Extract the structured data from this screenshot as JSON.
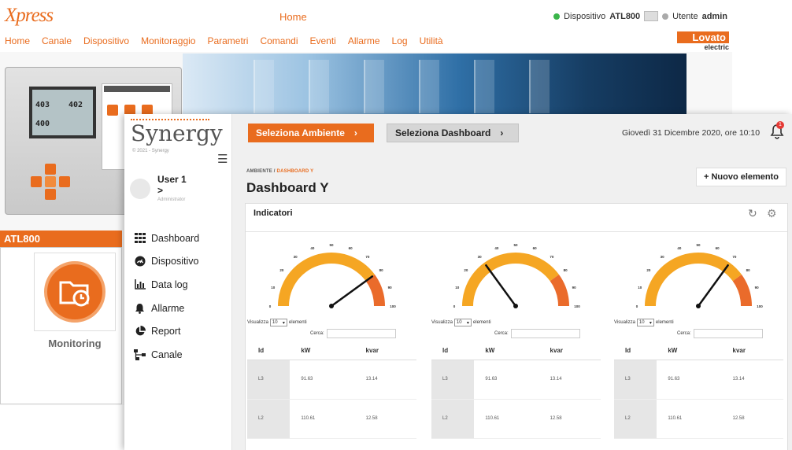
{
  "xpress": {
    "logo": "Xpress",
    "title": "Home",
    "device_label": "Dispositivo",
    "device_value": "ATL800",
    "user_label": "Utente",
    "user_value": "admin",
    "menu": [
      "Home",
      "Canale",
      "Dispositivo",
      "Monitoraggio",
      "Parametri",
      "Comandi",
      "Eventi",
      "Allarme",
      "Log",
      "Utilità"
    ],
    "brand": "Lovato",
    "brand_sub": "electric",
    "device_card_title": "ATL800",
    "tile_label": "Monitoring",
    "status_color": "#3ab54a",
    "accent": "#e96c1e"
  },
  "synergy": {
    "logo": "Synergy",
    "copyright": "© 2021 - Synergy",
    "user": {
      "name": "User 1",
      "chevron": ">",
      "role": "Administrator"
    },
    "nav": [
      {
        "label": "Dashboard",
        "icon": "dashboard-grid-icon"
      },
      {
        "label": "Dispositivo",
        "icon": "device-icon"
      },
      {
        "label": "Data log",
        "icon": "chart-icon"
      },
      {
        "label": "Allarme",
        "icon": "bell-icon"
      },
      {
        "label": "Report",
        "icon": "pie-icon"
      },
      {
        "label": "Canale",
        "icon": "network-icon"
      }
    ],
    "topbar": {
      "select_env": "Seleziona Ambiente",
      "select_dash": "Seleziona Dashboard",
      "date": "Giovedì 31 Dicembre 2020, ore 10:10",
      "notifications": "1"
    },
    "breadcrumb": {
      "root": "AMBIENTE",
      "sep": " / ",
      "current": "DASHBOARD Y"
    },
    "page_title": "Dashboard Y",
    "new_button": "+ Nuovo elemento",
    "panel_title": "Indicatori",
    "widgets": [
      {
        "gauge_value": 80,
        "ticks": [
          "0",
          "10",
          "20",
          "30",
          "40",
          "50",
          "60",
          "70",
          "80",
          "90",
          "100"
        ],
        "show_prefix": "Visualizza",
        "show_value": "10",
        "show_suffix": "elementi",
        "search_label": "Cerca:",
        "columns": [
          "Id",
          "kW",
          "kvar"
        ],
        "rows": [
          {
            "id": "L3",
            "kw": "91.63",
            "kvar": "13.14"
          },
          {
            "id": "L2",
            "kw": "110.61",
            "kvar": "12.58"
          }
        ]
      },
      {
        "gauge_value": 30,
        "ticks": [
          "0",
          "10",
          "20",
          "30",
          "40",
          "50",
          "60",
          "70",
          "80",
          "90",
          "100"
        ],
        "show_prefix": "Visualizza",
        "show_value": "10",
        "show_suffix": "elementi",
        "search_label": "Cerca:",
        "columns": [
          "Id",
          "kW",
          "kvar"
        ],
        "rows": [
          {
            "id": "L3",
            "kw": "91.63",
            "kvar": "13.14"
          },
          {
            "id": "L2",
            "kw": "110.61",
            "kvar": "12.58"
          }
        ]
      },
      {
        "gauge_value": 70,
        "ticks": [
          "0",
          "10",
          "20",
          "30",
          "40",
          "50",
          "60",
          "70",
          "80",
          "90",
          "100"
        ],
        "show_prefix": "Visualizza",
        "show_value": "10",
        "show_suffix": "elementi",
        "search_label": "Cerca:",
        "columns": [
          "Id",
          "kW",
          "kvar"
        ],
        "rows": [
          {
            "id": "L3",
            "kw": "91.63",
            "kvar": "13.14"
          },
          {
            "id": "L2",
            "kw": "110.61",
            "kvar": "12.58"
          }
        ]
      }
    ],
    "gauge_colors": {
      "main": "#f5a623",
      "danger": "#ea6b2b",
      "needle": "#111111"
    }
  }
}
